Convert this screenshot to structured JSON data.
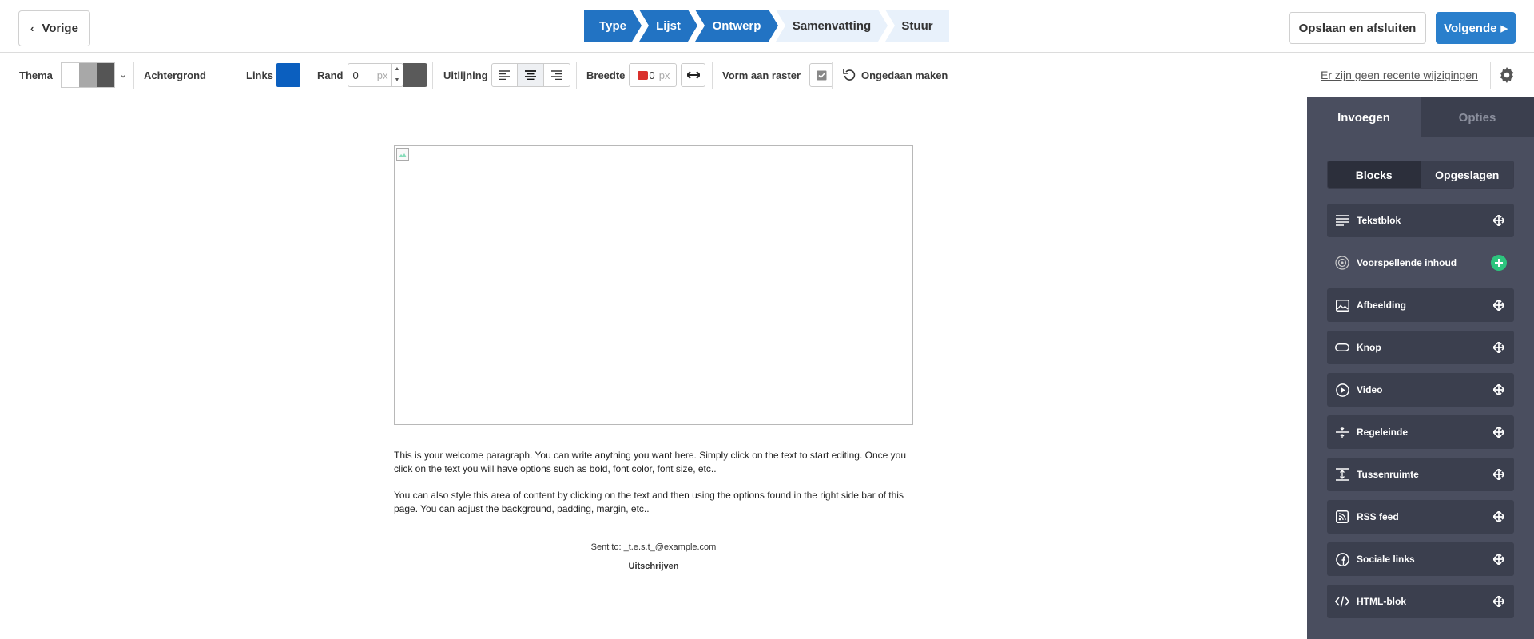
{
  "nav": {
    "prev_label": "Vorige",
    "save_label": "Opslaan en afsluiten",
    "next_label": "Volgende"
  },
  "steps": [
    "Type",
    "Lijst",
    "Ontwerp",
    "Samenvatting",
    "Stuur"
  ],
  "toolbar": {
    "theme_label": "Thema",
    "background_label": "Achtergrond",
    "links_label": "Links",
    "links_color": "#0b5fbf",
    "border_label": "Rand",
    "border_value": "0",
    "unit": "px",
    "align_label": "Uitlijning",
    "width_label": "Breedte",
    "width_value": "0",
    "grid_label": "Vorm aan raster",
    "undo_label": "Ongedaan maken",
    "changes_text": "Er zijn geen recente wijzigingen"
  },
  "email": {
    "para1": "This is your welcome paragraph. You can write anything you want here. Simply click on the text to start editing. Once you click on the text you will have options such as bold, font color, font size, etc..",
    "para2": "You can also style this area of content by clicking on the text and then using the options found in the right side bar of this page. You can adjust the background, padding, margin, etc..",
    "sent_to": "Sent to: _t.e.s.t_@example.com",
    "unsubscribe": "Uitschrijven"
  },
  "sidebar": {
    "tabs": [
      "Invoegen",
      "Opties"
    ],
    "segments": [
      "Blocks",
      "Opgeslagen"
    ],
    "blocks": [
      {
        "label": "Tekstblok",
        "icon": "text-lines-icon"
      },
      {
        "label": "Voorspellende inhoud",
        "icon": "predictive-icon"
      },
      {
        "label": "Afbeelding",
        "icon": "image-icon"
      },
      {
        "label": "Knop",
        "icon": "button-icon"
      },
      {
        "label": "Video",
        "icon": "play-icon"
      },
      {
        "label": "Regeleinde",
        "icon": "divider-icon"
      },
      {
        "label": "Tussenruimte",
        "icon": "spacer-icon"
      },
      {
        "label": "RSS feed",
        "icon": "rss-icon"
      },
      {
        "label": "Sociale links",
        "icon": "facebook-icon"
      },
      {
        "label": "HTML-blok",
        "icon": "code-icon"
      }
    ]
  },
  "colors": {
    "primary": "#2273c3",
    "sidebar_bg": "#4a4e5f",
    "block_bg": "#3b3f4e",
    "add_green": "#2dc57e"
  }
}
